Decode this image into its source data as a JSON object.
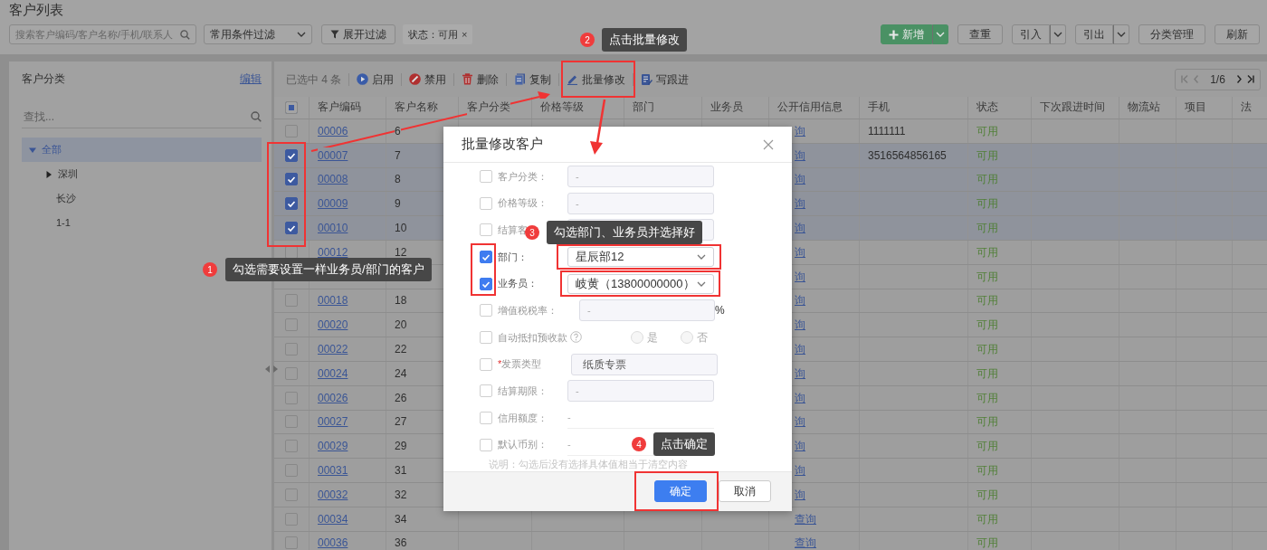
{
  "page_title": "客户列表",
  "filter_bar": {
    "search": {
      "placeholder": "搜索客户编码/客户名称/手机/联系人"
    },
    "preset": {
      "value": "常用条件过滤"
    },
    "expand_button": "展开过滤",
    "tags": [
      {
        "label": "状态：可用",
        "close": "×"
      }
    ]
  },
  "actions": [
    {
      "label": "新增",
      "kind": "primary-split"
    },
    {
      "label": "查重",
      "kind": "plain"
    },
    {
      "label": "引入",
      "kind": "split"
    },
    {
      "label": "引出",
      "kind": "split"
    },
    {
      "label": "分类管理",
      "kind": "plain"
    },
    {
      "label": "刷新",
      "kind": "plain"
    }
  ],
  "sidebar": {
    "title": "客户分类",
    "edit_link": "编辑",
    "search": {
      "placeholder": "查找..."
    },
    "tree": [
      {
        "label": "全部",
        "expanded": true,
        "selected": true,
        "children": [
          {
            "label": "深圳",
            "expanded": false,
            "selected": false
          },
          {
            "label": "长沙",
            "selected": false
          },
          {
            "label": "1-1",
            "selected": false
          }
        ]
      }
    ]
  },
  "toolbar": {
    "selection_count": "已选中 4 条",
    "buttons": [
      {
        "label": "启用",
        "kind": "play"
      },
      {
        "label": "禁用",
        "kind": "ban"
      },
      {
        "label": "删除",
        "kind": "trash"
      },
      {
        "label": "复制",
        "kind": "copy"
      },
      {
        "label": "批量修改",
        "kind": "pencil"
      },
      {
        "label": "写跟进",
        "kind": "followup"
      }
    ]
  },
  "pager": {
    "text": "1/6"
  },
  "table": {
    "select_all": {
      "partial": true
    },
    "columns": [
      "客户编码",
      "客户名称",
      "客户分类",
      "价格等级",
      "部门",
      "业务员",
      "公开信用信息",
      "手机",
      "状态",
      "下次跟进时间",
      "物流站",
      "项目",
      "法"
    ],
    "rows": [
      {
        "code": "00006",
        "name": "6",
        "credit": "询",
        "phone": "1111111",
        "status": "可用",
        "checked": false
      },
      {
        "code": "00007",
        "name": "7",
        "credit": "询",
        "phone": "3516564856165",
        "status": "可用",
        "checked": true
      },
      {
        "code": "00008",
        "name": "8",
        "credit": "询",
        "status": "可用",
        "checked": true
      },
      {
        "code": "00009",
        "name": "9",
        "credit": "询",
        "status": "可用",
        "checked": true
      },
      {
        "code": "00010",
        "name": "10",
        "credit": "询",
        "status": "可用",
        "checked": true
      },
      {
        "code": "00012",
        "name": "12",
        "credit": "询",
        "status": "可用",
        "checked": false
      },
      {
        "credit": "询",
        "status": "可用"
      },
      {
        "code": "00018",
        "name": "18",
        "credit": "询",
        "status": "可用",
        "checked": false
      },
      {
        "code": "00020",
        "name": "20",
        "credit": "询",
        "status": "可用",
        "checked": false
      },
      {
        "code": "00022",
        "name": "22",
        "credit": "询",
        "status": "可用",
        "checked": false
      },
      {
        "code": "00024",
        "name": "24",
        "credit": "询",
        "status": "可用",
        "checked": false
      },
      {
        "code": "00026",
        "name": "26",
        "credit": "询",
        "status": "可用",
        "checked": false
      },
      {
        "code": "00027",
        "name": "27",
        "credit": "询",
        "status": "可用",
        "checked": false
      },
      {
        "code": "00029",
        "name": "29",
        "credit": "询",
        "status": "可用",
        "checked": false
      },
      {
        "code": "00031",
        "name": "31",
        "credit": "询",
        "status": "可用",
        "checked": false
      },
      {
        "code": "00032",
        "name": "32",
        "credit": "询",
        "status": "可用",
        "checked": false
      },
      {
        "code": "00034",
        "name": "34",
        "credit": "查询",
        "status": "可用",
        "checked": false
      },
      {
        "code": "00036",
        "name": "36",
        "credit": "查询",
        "status": "可用",
        "checked": false
      }
    ]
  },
  "dialog": {
    "title": "批量修改客户",
    "fields": [
      {
        "kind": "input",
        "label": "客户分类：",
        "checked": false,
        "placeholder": "-"
      },
      {
        "kind": "input",
        "label": "价格等级：",
        "checked": false,
        "placeholder": "-"
      },
      {
        "kind": "input",
        "label": "结算客",
        "checked": false
      },
      {
        "kind": "select",
        "label": "部门：",
        "checked": true,
        "value": "星辰部12"
      },
      {
        "kind": "select",
        "label": "业务员：",
        "checked": true,
        "value": "岐黄（13800000000）"
      },
      {
        "kind": "input",
        "label": "增值税税率：",
        "checked": false,
        "placeholder": "-",
        "unit": "%"
      },
      {
        "kind": "radio",
        "label": "自动抵扣预收款",
        "checked": false,
        "help": true,
        "options": [
          {
            "label": "是",
            "selected": false
          },
          {
            "label": "否",
            "selected": false
          }
        ]
      },
      {
        "kind": "locked",
        "label": "发票类型",
        "required_mark": "*",
        "checked": false,
        "value": "纸质专票"
      },
      {
        "kind": "input",
        "label": "结算期限：",
        "checked": false,
        "placeholder": "-"
      },
      {
        "kind": "plain",
        "label": "信用额度：",
        "checked": false,
        "value": "-"
      },
      {
        "kind": "plain",
        "label": "默认币别：",
        "checked": false,
        "value": "-"
      }
    ],
    "note": "说明：勾选后没有选择具体值相当于清空内容",
    "buttons": [
      {
        "label": "确定",
        "kind": "primary"
      },
      {
        "label": "取消",
        "kind": "secondary"
      }
    ]
  },
  "callouts": [
    {
      "number": "1",
      "text": "勾选需要设置一样业务员/部门的客户"
    },
    {
      "number": "2",
      "text": "点击批量修改"
    },
    {
      "number": "3",
      "text": "勾选部门、业务员并选择好"
    },
    {
      "number": "4",
      "text": "点击确定"
    }
  ]
}
